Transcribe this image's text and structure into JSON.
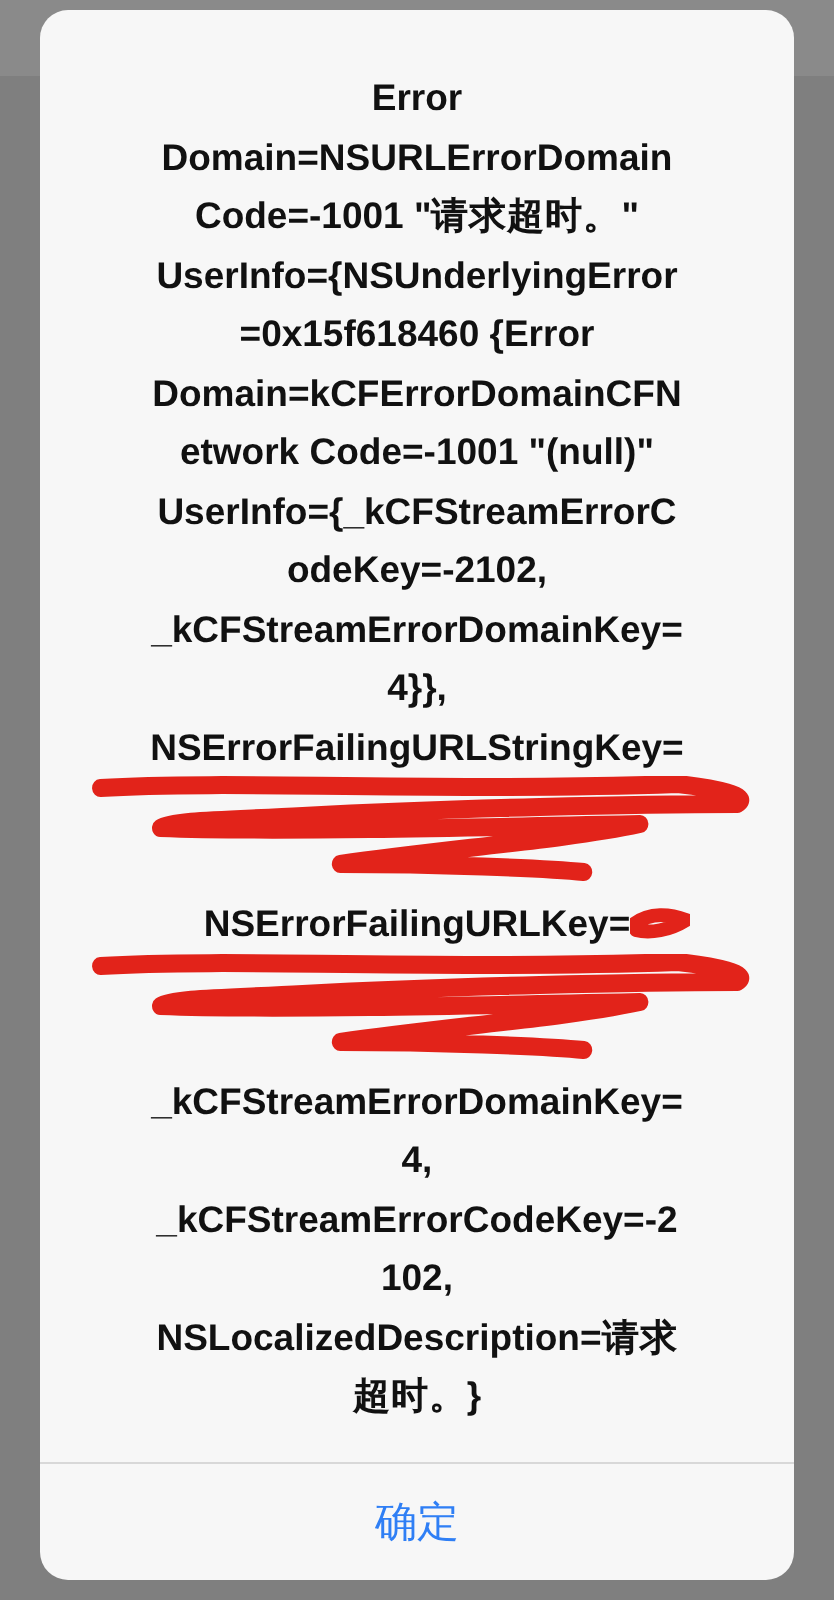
{
  "alert": {
    "message": [
      {
        "kind": "text",
        "lines": [
          "Error",
          "Domain=NSURLErrorDomain",
          "Code=-1001 \"请求超时。\"",
          "UserInfo={NSUnderlyingError",
          "=0x15f618460 {Error",
          "Domain=kCFErrorDomainCFN",
          "etwork Code=-1001 \"(null)\"",
          "UserInfo={_kCFStreamErrorC",
          "odeKey=-2102,",
          "_kCFStreamErrorDomainKey=",
          "4}},",
          "NSErrorFailingURLStringKey="
        ],
        "redacted_tail": false
      },
      {
        "kind": "redacted"
      },
      {
        "kind": "text",
        "lines": [
          "NSErrorFailingURLKey="
        ],
        "redacted_tail": true
      },
      {
        "kind": "redacted"
      },
      {
        "kind": "text",
        "lines": [
          "_kCFStreamErrorDomainKey=",
          "4,",
          "_kCFStreamErrorCodeKey=-2",
          "102,",
          "NSLocalizedDescription=请求",
          "超时。}"
        ],
        "redacted_tail": false
      }
    ],
    "buttons": [
      {
        "label": "确定"
      }
    ]
  }
}
